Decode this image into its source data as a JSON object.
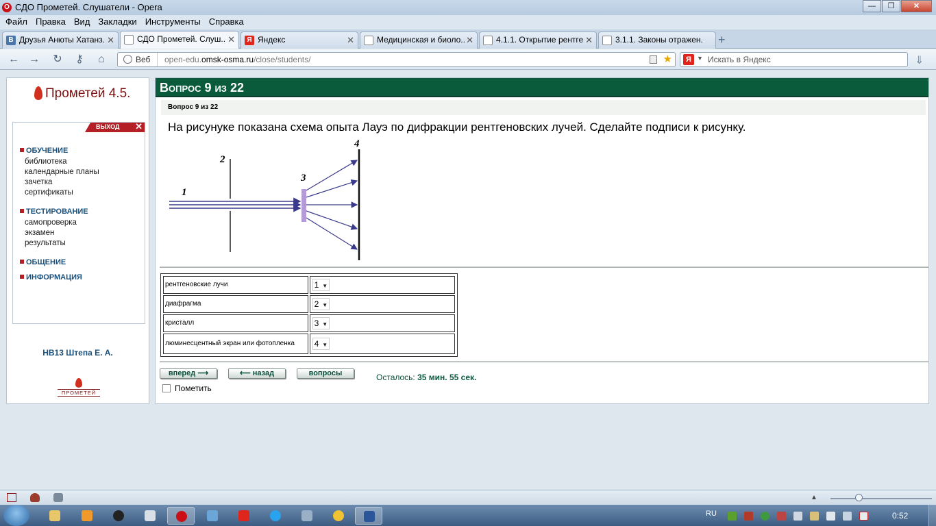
{
  "window": {
    "title": "СДО Прометей. Слушатели - Opera",
    "controls": {
      "minimize": "—",
      "maximize": "❐",
      "close": "✕"
    }
  },
  "menubar": [
    "Файл",
    "Правка",
    "Вид",
    "Закладки",
    "Инструменты",
    "Справка"
  ],
  "tabs": [
    {
      "label": "Друзья Анюты Хатанз...",
      "icon": "В",
      "icon_color": "#4a76a8",
      "active": false
    },
    {
      "label": "СДО Прометей. Слуш...",
      "icon": "",
      "icon_color": "#ffffff",
      "active": true
    },
    {
      "label": "Яндекс",
      "icon": "Я",
      "icon_color": "#e0261c",
      "active": false
    },
    {
      "label": "Медицинская и биоло...",
      "icon": "",
      "icon_color": "#ffffff",
      "active": false
    },
    {
      "label": "4.1.1. Открытие рентге...",
      "icon": "",
      "icon_color": "#ffffff",
      "active": false
    },
    {
      "label": "3.1.1. Законы отражен...",
      "icon": "",
      "icon_color": "#ffffff",
      "active": false
    }
  ],
  "navbar": {
    "web_label": "Веб",
    "url_prefix": "open-edu.",
    "url_domain": "omsk-osma.ru",
    "url_path": "/close/students/",
    "search_placeholder": "Искать в Яндекс",
    "search_engine_glyph": "Я"
  },
  "sidebar": {
    "logo_text": "Прометей 4.5.",
    "exit_label": "ВЫХОД",
    "sections": [
      {
        "title": "ОБУЧЕНИЕ",
        "items": [
          "библиотека",
          "календарные планы",
          "зачетка",
          "сертификаты"
        ]
      },
      {
        "title": "ТЕСТИРОВАНИЕ",
        "items": [
          "самопроверка",
          "экзамен",
          "результаты"
        ]
      },
      {
        "title": "ОБЩЕНИЕ",
        "items": []
      },
      {
        "title": "ИНФОРМАЦИЯ",
        "items": []
      }
    ],
    "student": "НВ13 Штепа Е. А.",
    "bottom_logo_text": "ПРОМЕТЕЙ"
  },
  "question": {
    "header": "Вопрос 9 из 22",
    "subheader": "Вопрос 9 из 22",
    "text": "На рисунуке показана схема опыта Лауэ по дифракции рентгеновских лучей. Сделайте подписи к рисунку.",
    "figure_labels": [
      "1",
      "2",
      "3",
      "4"
    ],
    "answers": [
      {
        "label": "рентгеновские лучи",
        "value": "1"
      },
      {
        "label": "диафрагма",
        "value": "2"
      },
      {
        "label": "кристалл",
        "value": "3"
      },
      {
        "label": "люминесцентный экран или фотопленка",
        "value": "4"
      }
    ]
  },
  "controls": {
    "forward": "вперед",
    "back": "назад",
    "questions": "вопросы",
    "timer_label": "Осталось:",
    "timer_value": "35 мин. 55 сек.",
    "mark_label": "Пометить"
  },
  "taskbar": {
    "language": "RU",
    "clock": "0:52"
  },
  "colors": {
    "header_green": "#0a5a3c",
    "accent_red": "#b41e25",
    "link_blue": "#1a4f7a",
    "crystal": "#b59ad8",
    "rays": "#3a3a8c"
  }
}
